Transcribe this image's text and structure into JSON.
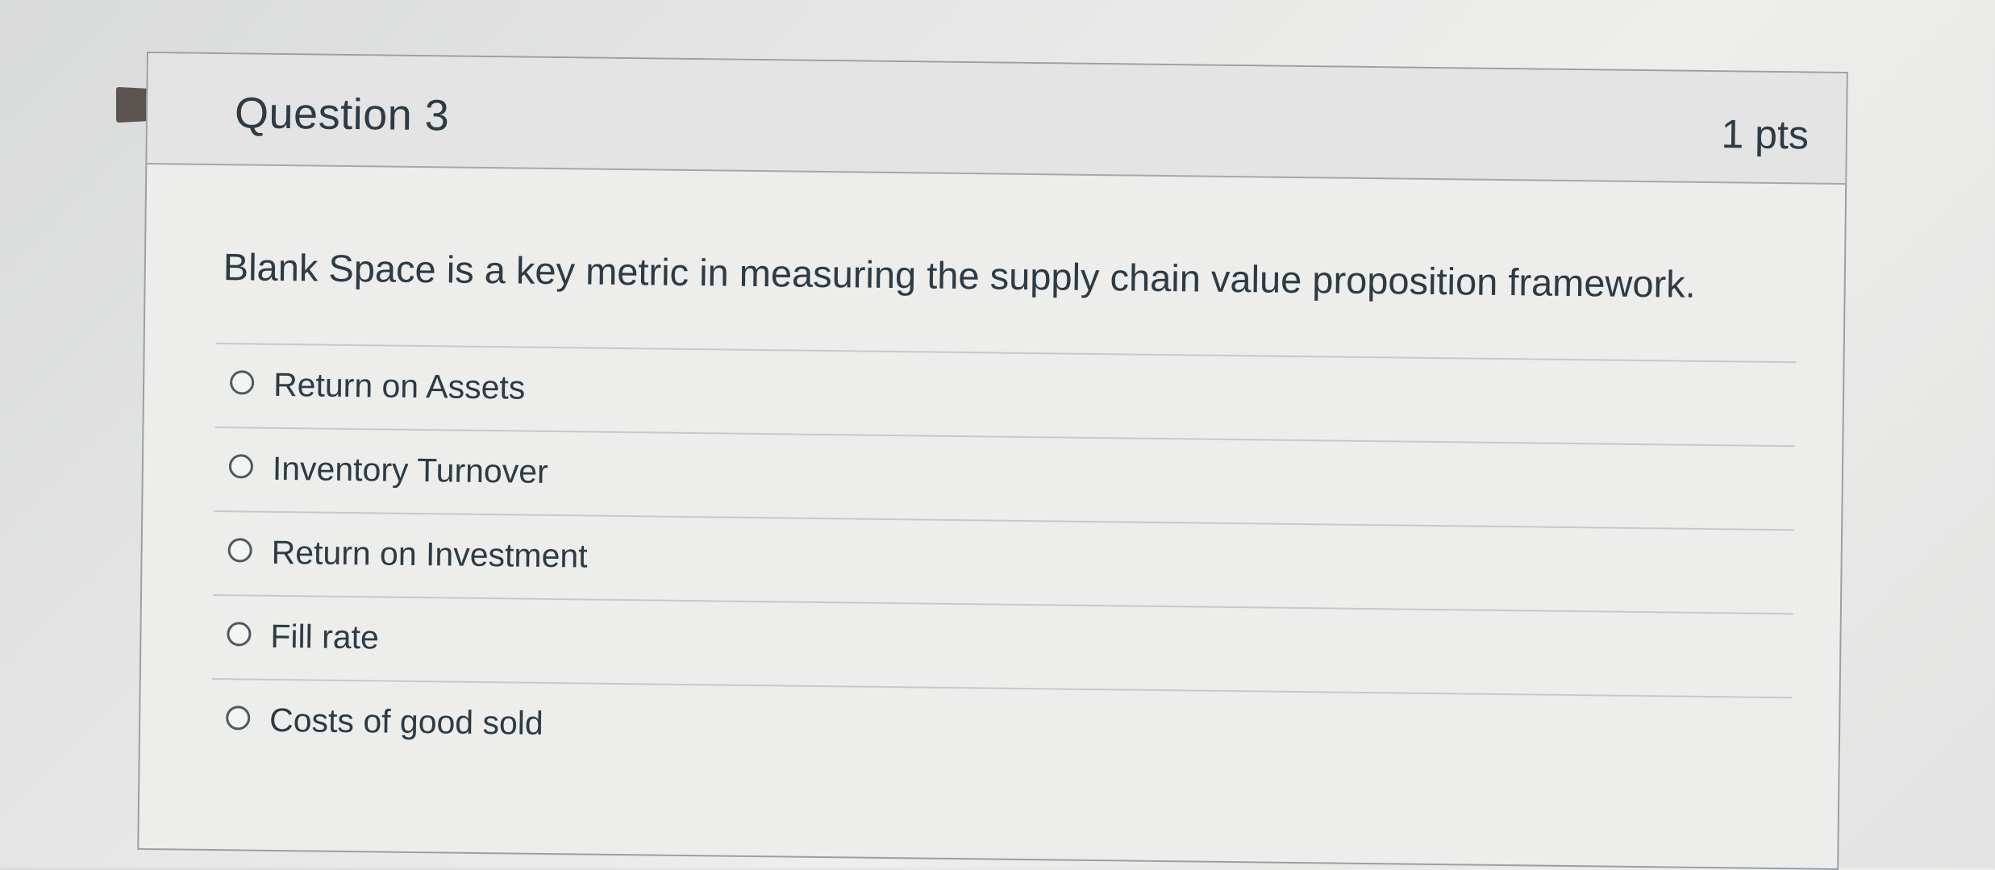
{
  "question": {
    "title": "Question 3",
    "points": "1 pts",
    "text": "Blank Space is a key metric in measuring the supply chain value proposition framework.",
    "flag_icon": "bookmark-flag-icon",
    "answers": [
      {
        "label": "Return on Assets",
        "selected": false
      },
      {
        "label": "Inventory Turnover",
        "selected": false
      },
      {
        "label": "Return on Investment",
        "selected": false
      },
      {
        "label": "Fill rate",
        "selected": false
      },
      {
        "label": "Costs of good sold",
        "selected": false
      }
    ]
  },
  "colors": {
    "flag": "#5c5450",
    "text": "#2d3b45",
    "border": "#9aa0a4"
  }
}
